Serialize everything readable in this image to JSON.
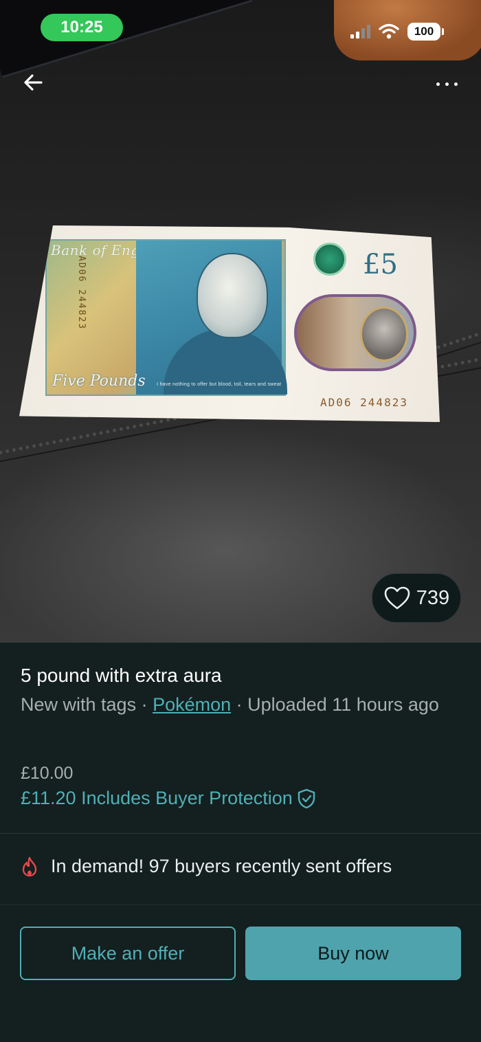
{
  "status_bar": {
    "time": "10:25",
    "battery": "100"
  },
  "photo": {
    "banknote": {
      "bank_title": "Bank of England",
      "denomination": "£5",
      "words": "Five Pounds",
      "serial": "AD06 244823",
      "quote": "I have nothing to offer but blood, toil, tears and sweat"
    },
    "likes": "739"
  },
  "item": {
    "title": "5 pound with extra aura",
    "condition": "New with tags",
    "separator": " · ",
    "brand": "Pokémon",
    "uploaded": "Uploaded 11 hours ago",
    "price": "£10.00",
    "total_price": "£11.20 Includes Buyer Protection"
  },
  "demand": {
    "text": "In demand! 97 buyers recently sent offers"
  },
  "actions": {
    "offer_label": "Make an offer",
    "buy_label": "Buy now"
  },
  "colors": {
    "accent": "#4fb0b7",
    "background": "#141f1f",
    "status_pill": "#34c759",
    "demand_icon": "#e5484d"
  }
}
